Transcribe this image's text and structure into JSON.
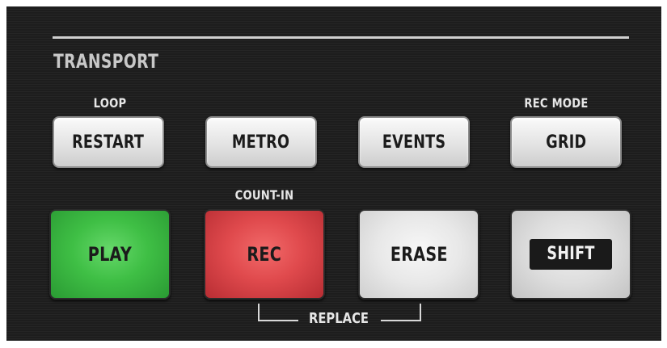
{
  "section": {
    "title": "TRANSPORT"
  },
  "labels": {
    "loop": "LOOP",
    "rec_mode": "REC MODE",
    "count_in": "COUNT-IN",
    "replace": "REPLACE"
  },
  "small_buttons": [
    {
      "label": "RESTART"
    },
    {
      "label": "METRO"
    },
    {
      "label": "EVENTS"
    },
    {
      "label": "GRID"
    }
  ],
  "large_buttons": [
    {
      "label": "PLAY",
      "color": "#3fbf45"
    },
    {
      "label": "REC",
      "color": "#e04a4d"
    },
    {
      "label": "ERASE",
      "color": "#e8e8e8"
    },
    {
      "label": "SHIFT",
      "color": "#dddddd"
    }
  ],
  "colors": {
    "panel_background": "#1d1d1d",
    "label_text": "#e6e6e6",
    "section_title": "#c8c8c8"
  }
}
